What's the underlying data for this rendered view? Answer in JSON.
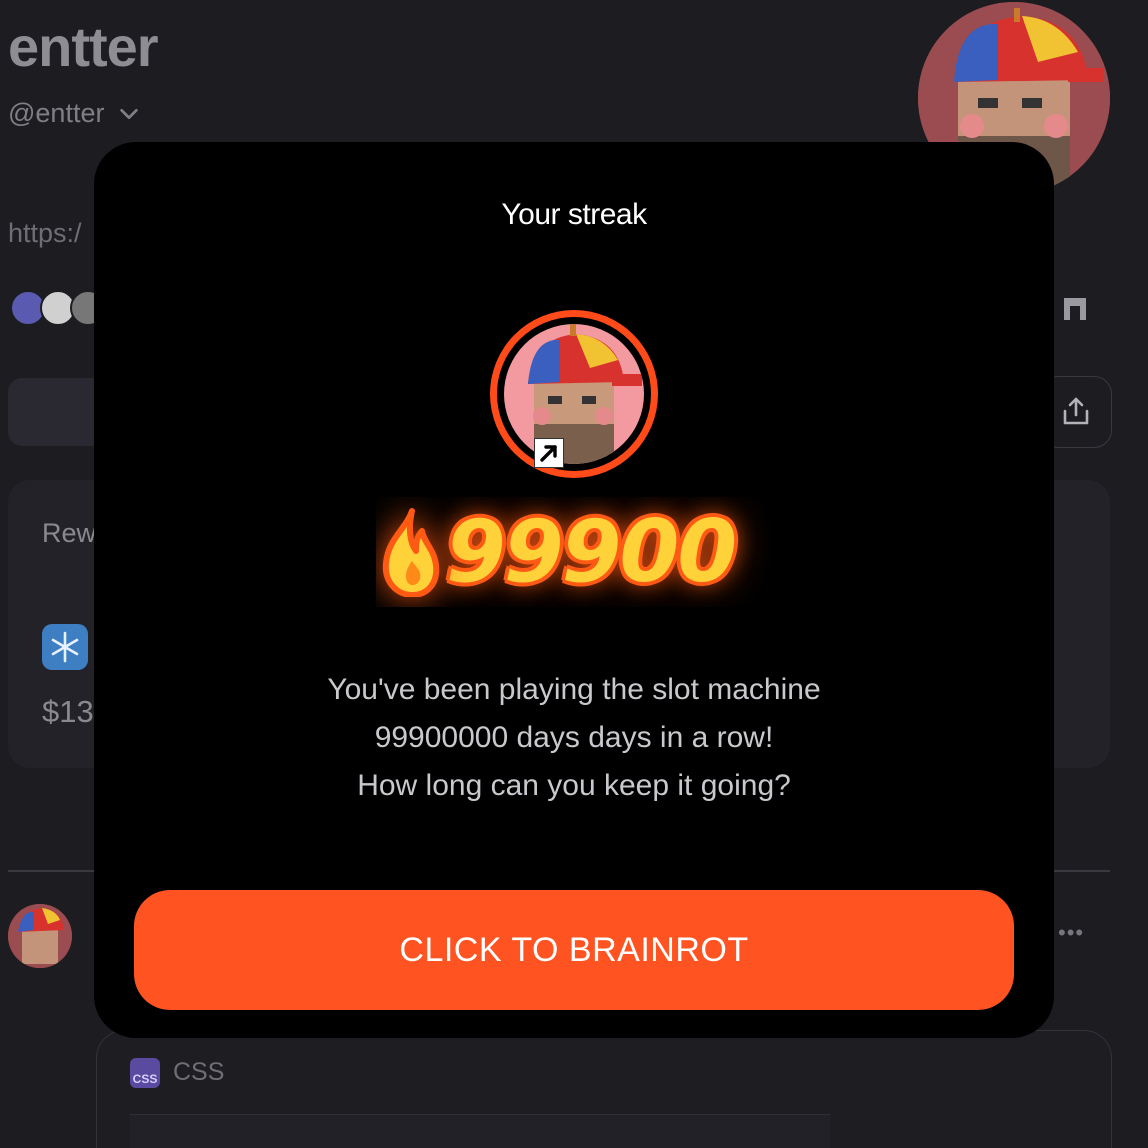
{
  "profile": {
    "name": "entter",
    "handle": "@entter",
    "link": "https:/",
    "card_label": "Rew",
    "amount": "$13"
  },
  "post": {
    "more_label": "•••",
    "code_badge": "CSS",
    "code_language": "CSS"
  },
  "modal": {
    "title": "Your streak",
    "streak_count": "99900",
    "message_lines": [
      "You've been playing the slot machine",
      "99900000 days days in a row!",
      "How long can you keep it going?"
    ],
    "cta_label": "CLICK TO BRAINROT"
  },
  "colors": {
    "accent": "#ff5322",
    "streak_yellow": "#ffd23a",
    "modal_bg": "#000000",
    "page_bg": "#1d1c21"
  },
  "icons": {
    "handle_dropdown": "chevron-down-icon",
    "share": "share-icon",
    "gate": "gate-icon",
    "flame": "flame-icon",
    "shortcut": "shortcut-arrow-icon"
  }
}
